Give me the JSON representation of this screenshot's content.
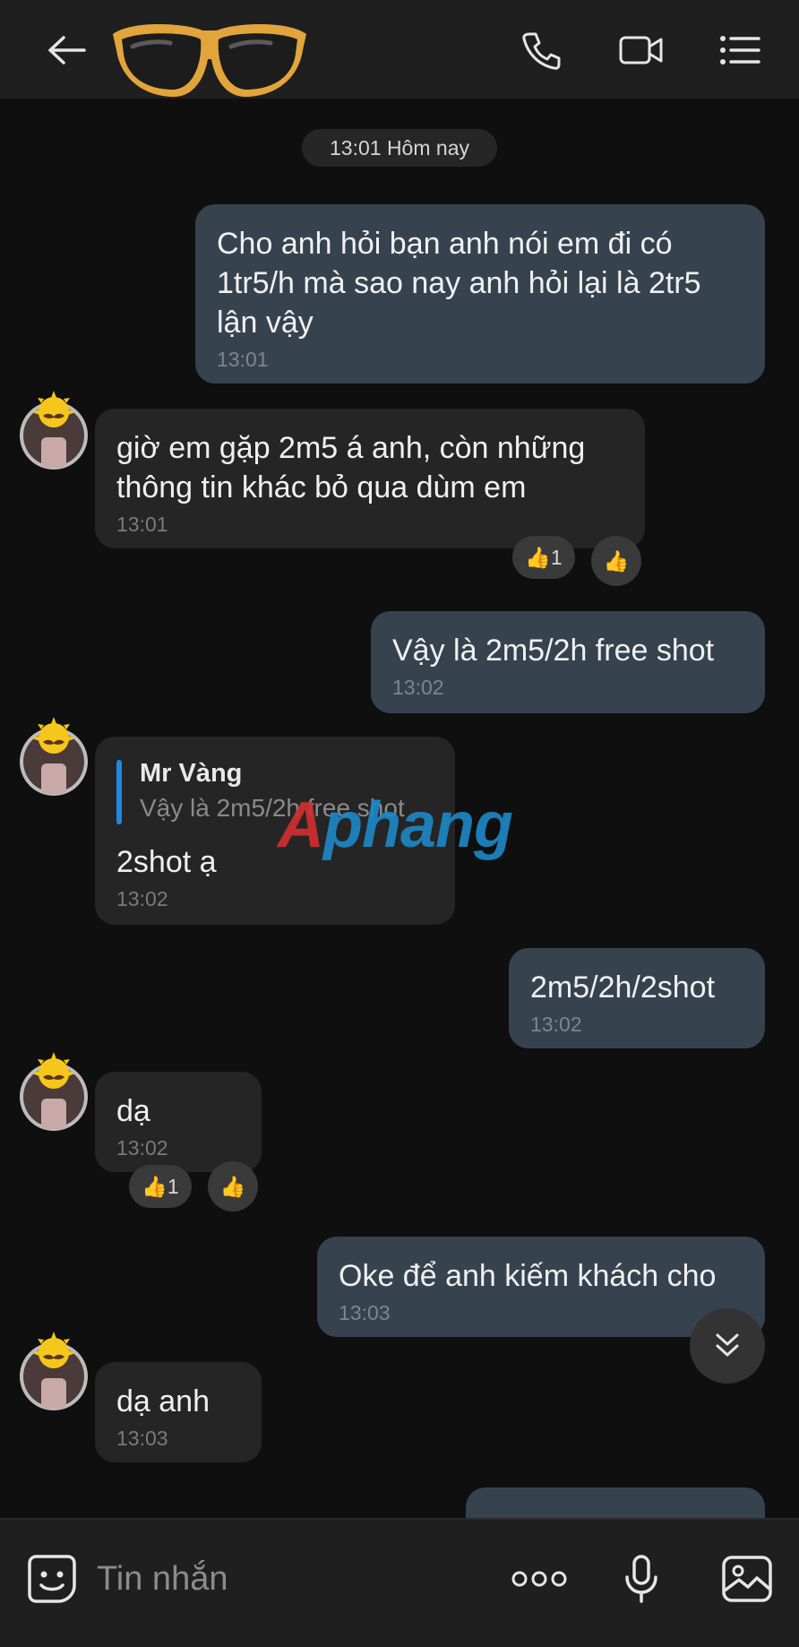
{
  "date_separator": "13:01 Hôm nay",
  "watermark": {
    "part1": "A",
    "part2": "phang"
  },
  "messages": [
    {
      "text": "Cho anh hỏi bạn anh nói em đi có\n1tr5/h mà sao nay anh hỏi lại là 2tr5\nlận vậy",
      "time": "13:01"
    },
    {
      "text": "giờ em gặp 2m5 á anh, còn những\nthông tin khác bỏ qua dùm em",
      "time": "13:01",
      "reaction_count": "1"
    },
    {
      "text": "Vậy là 2m5/2h free shot",
      "time": "13:02"
    },
    {
      "quote_name": "Mr Vàng",
      "quote_text": "Vậy là 2m5/2h free shot",
      "text": "2shot ạ",
      "time": "13:02"
    },
    {
      "text": "2m5/2h/2shot",
      "time": "13:02"
    },
    {
      "text": "dạ",
      "time": "13:02",
      "reaction_count": "1"
    },
    {
      "text": "Oke để anh kiếm khách cho",
      "time": "13:03"
    },
    {
      "text": "dạ anh",
      "time": "13:03"
    }
  ],
  "composer": {
    "placeholder": "Tin nhắn"
  }
}
